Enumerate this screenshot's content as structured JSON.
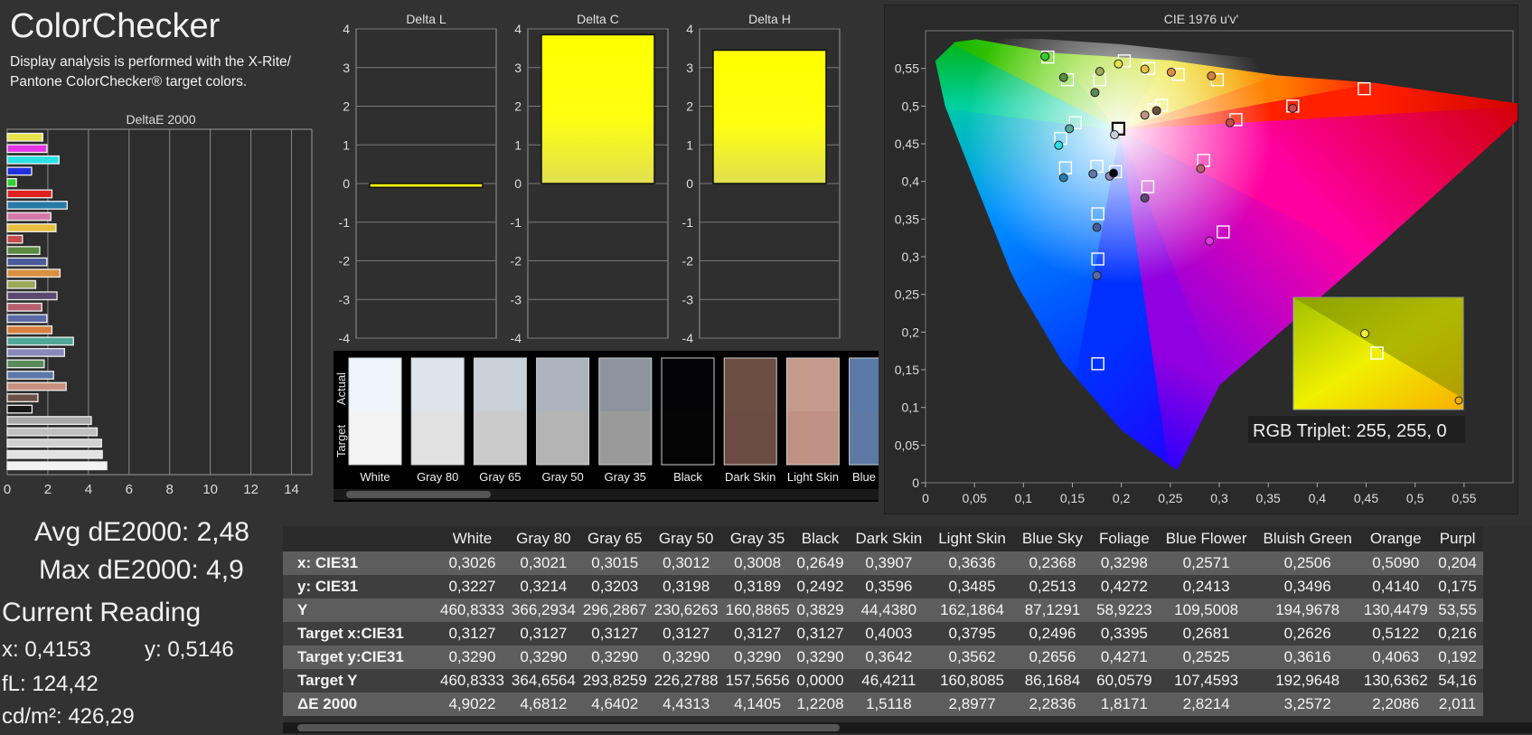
{
  "title": "ColorChecker",
  "subtitle": "Display analysis is performed with the X-Rite/ Pantone ColorChecker® target colors.",
  "de_chart": {
    "title": "DeltaE 2000",
    "xlim": [
      0,
      15
    ],
    "ticks": [
      "0",
      "2",
      "4",
      "6",
      "8",
      "10",
      "12",
      "14"
    ],
    "tick_values": [
      0,
      2,
      4,
      6,
      8,
      10,
      12,
      14
    ],
    "bars": [
      {
        "v": 1.75,
        "c": "#e8e34a"
      },
      {
        "v": 1.95,
        "c": "#e535e5"
      },
      {
        "v": 2.55,
        "c": "#2ae0e4"
      },
      {
        "v": 1.2,
        "c": "#2030e0"
      },
      {
        "v": 0.45,
        "c": "#30d030"
      },
      {
        "v": 2.2,
        "c": "#e02020"
      },
      {
        "v": 2.95,
        "c": "#2a7aa8"
      },
      {
        "v": 2.15,
        "c": "#d57aa8"
      },
      {
        "v": 2.4,
        "c": "#e8c040"
      },
      {
        "v": 0.75,
        "c": "#c84a4a"
      },
      {
        "v": 1.6,
        "c": "#5a8a40"
      },
      {
        "v": 1.95,
        "c": "#4a5a9a"
      },
      {
        "v": 2.6,
        "c": "#d89040"
      },
      {
        "v": 1.4,
        "c": "#9aa858"
      },
      {
        "v": 2.45,
        "c": "#5a4870"
      },
      {
        "v": 1.7,
        "c": "#b86070"
      },
      {
        "v": 1.95,
        "c": "#5a6aa8"
      },
      {
        "v": 2.2,
        "c": "#d88040"
      },
      {
        "v": 3.26,
        "c": "#50a898"
      },
      {
        "v": 2.82,
        "c": "#8a88b8"
      },
      {
        "v": 1.82,
        "c": "#5a8a58"
      },
      {
        "v": 2.28,
        "c": "#5a78a8"
      },
      {
        "v": 2.9,
        "c": "#c89080"
      },
      {
        "v": 1.51,
        "c": "#6a5048"
      },
      {
        "v": 1.22,
        "c": "#181818"
      },
      {
        "v": 4.14,
        "c": "#a8a8a8"
      },
      {
        "v": 4.43,
        "c": "#c0c0c0"
      },
      {
        "v": 4.64,
        "c": "#d0d0d0"
      },
      {
        "v": 4.68,
        "c": "#e2e2e2"
      },
      {
        "v": 4.9,
        "c": "#f2f2f2"
      }
    ]
  },
  "stats": {
    "avg": "Avg dE2000: 2,48",
    "max": "Max dE2000: 4,9",
    "current_title": "Current Reading",
    "x": "x: 0,4153",
    "y": "y: 0,5146",
    "fl": "fL: 124,42",
    "cd": "cd/m²: 426,29"
  },
  "delta_charts": {
    "y_ticks": [
      "4",
      "3",
      "2",
      "1",
      "0",
      "-1",
      "-2",
      "-3",
      "-4"
    ],
    "y_tick_values": [
      4,
      3,
      2,
      1,
      0,
      -1,
      -2,
      -3,
      -4
    ],
    "items": [
      {
        "title": "Delta L",
        "value": -0.1
      },
      {
        "title": "Delta C",
        "value": 3.85
      },
      {
        "title": "Delta H",
        "value": 3.45
      }
    ],
    "bar_color": "#ffff00"
  },
  "swatches": {
    "actual_label": "Actual",
    "target_label": "Target",
    "items": [
      {
        "name": "White",
        "actual": "#eef6fc",
        "target": "#f3f3f3"
      },
      {
        "name": "Gray 80",
        "actual": "#dde4ec",
        "target": "#e2e2e2"
      },
      {
        "name": "Gray 65",
        "actual": "#c8d0d8",
        "target": "#cbcbcb"
      },
      {
        "name": "Gray 50",
        "actual": "#adb4bd",
        "target": "#b4b4b4"
      },
      {
        "name": "Gray 35",
        "actual": "#8e949d",
        "target": "#9a9a9a"
      },
      {
        "name": "Black",
        "actual": "#040406",
        "target": "#050505"
      },
      {
        "name": "Dark Skin",
        "actual": "#6d4e42",
        "target": "#6c4c42"
      },
      {
        "name": "Light Skin",
        "actual": "#c59a8c",
        "target": "#c09286"
      },
      {
        "name": "Blue Sky",
        "actual": "#5a7aa8",
        "target": "#5e7aa4"
      }
    ]
  },
  "cie_chart": {
    "title": "CIE 1976 u'v'",
    "x_ticks": [
      "0",
      "0,05",
      "0,1",
      "0,15",
      "0,2",
      "0,25",
      "0,3",
      "0,35",
      "0,4",
      "0,45",
      "0,5",
      "0,55"
    ],
    "x_tick_values": [
      0,
      0.05,
      0.1,
      0.15,
      0.2,
      0.25,
      0.3,
      0.35,
      0.4,
      0.45,
      0.5,
      0.55
    ],
    "y_ticks": [
      "0",
      "0,05",
      "0,1",
      "0,15",
      "0,2",
      "0,25",
      "0,3",
      "0,35",
      "0,4",
      "0,45",
      "0,5",
      "0,55"
    ],
    "y_tick_values": [
      0,
      0.05,
      0.1,
      0.15,
      0.2,
      0.25,
      0.3,
      0.35,
      0.4,
      0.45,
      0.5,
      0.55
    ],
    "xlim": [
      0,
      0.6
    ],
    "ylim": [
      0,
      0.6
    ],
    "targets": [
      [
        0.125,
        0.565
      ],
      [
        0.145,
        0.535
      ],
      [
        0.178,
        0.535
      ],
      [
        0.203,
        0.56
      ],
      [
        0.228,
        0.55
      ],
      [
        0.258,
        0.542
      ],
      [
        0.298,
        0.535
      ],
      [
        0.448,
        0.523
      ],
      [
        0.375,
        0.5
      ],
      [
        0.241,
        0.501
      ],
      [
        0.233,
        0.495
      ],
      [
        0.317,
        0.482
      ],
      [
        0.153,
        0.478
      ],
      [
        0.138,
        0.457
      ],
      [
        0.197,
        0.47
      ],
      [
        0.143,
        0.418
      ],
      [
        0.175,
        0.42
      ],
      [
        0.194,
        0.413
      ],
      [
        0.284,
        0.428
      ],
      [
        0.227,
        0.393
      ],
      [
        0.176,
        0.357
      ],
      [
        0.304,
        0.333
      ],
      [
        0.176,
        0.297
      ],
      [
        0.176,
        0.158
      ]
    ],
    "actual_points": [
      {
        "u": 0.122,
        "v": 0.566,
        "c": "#30d030"
      },
      {
        "u": 0.141,
        "v": 0.538,
        "c": "#5a8a40"
      },
      {
        "u": 0.178,
        "v": 0.546,
        "c": "#9aa858"
      },
      {
        "u": 0.197,
        "v": 0.556,
        "c": "#e8e34a"
      },
      {
        "u": 0.224,
        "v": 0.549,
        "c": "#e8c040"
      },
      {
        "u": 0.251,
        "v": 0.545,
        "c": "#d89040"
      },
      {
        "u": 0.292,
        "v": 0.54,
        "c": "#d88040"
      },
      {
        "u": 0.375,
        "v": 0.497,
        "c": "#c84a4a"
      },
      {
        "u": 0.236,
        "v": 0.494,
        "c": "#6d4e42"
      },
      {
        "u": 0.224,
        "v": 0.488,
        "c": "#c09286"
      },
      {
        "u": 0.311,
        "v": 0.478,
        "c": "#c84a4a"
      },
      {
        "u": 0.173,
        "v": 0.518,
        "c": "#5a8a58"
      },
      {
        "u": 0.147,
        "v": 0.47,
        "c": "#50a898"
      },
      {
        "u": 0.136,
        "v": 0.448,
        "c": "#2ae0e4"
      },
      {
        "u": 0.193,
        "v": 0.462,
        "c": "#c8d0d8"
      },
      {
        "u": 0.141,
        "v": 0.405,
        "c": "#2a7aa8"
      },
      {
        "u": 0.171,
        "v": 0.41,
        "c": "#5a78a8"
      },
      {
        "u": 0.188,
        "v": 0.407,
        "c": "#8a88b8"
      },
      {
        "u": 0.192,
        "v": 0.411,
        "c": "#040406"
      },
      {
        "u": 0.281,
        "v": 0.417,
        "c": "#b86070"
      },
      {
        "u": 0.224,
        "v": 0.378,
        "c": "#5a4870"
      },
      {
        "u": 0.175,
        "v": 0.339,
        "c": "#4a5a9a"
      },
      {
        "u": 0.29,
        "v": 0.321,
        "c": "#e535e5"
      },
      {
        "u": 0.175,
        "v": 0.275,
        "c": "#5a6aa8"
      }
    ],
    "selected_target": [
      0.197,
      0.47
    ],
    "inset": {
      "actual": {
        "u": 0.5,
        "v": 0.52,
        "c": "#e8e34a"
      },
      "target_label": "RGB Triplet: 255, 255, 0"
    }
  },
  "table": {
    "columns": [
      "White",
      "Gray 80",
      "Gray 65",
      "Gray 50",
      "Gray 35",
      "Black",
      "Dark Skin",
      "Light Skin",
      "Blue Sky",
      "Foliage",
      "Blue Flower",
      "Bluish Green",
      "Orange",
      "Purpl"
    ],
    "rows": [
      {
        "label": "x: CIE31",
        "values": [
          "0,3026",
          "0,3021",
          "0,3015",
          "0,3012",
          "0,3008",
          "0,2649",
          "0,3907",
          "0,3636",
          "0,2368",
          "0,3298",
          "0,2571",
          "0,2506",
          "0,5090",
          "0,204"
        ]
      },
      {
        "label": "y: CIE31",
        "values": [
          "0,3227",
          "0,3214",
          "0,3203",
          "0,3198",
          "0,3189",
          "0,2492",
          "0,3596",
          "0,3485",
          "0,2513",
          "0,4272",
          "0,2413",
          "0,3496",
          "0,4140",
          "0,175"
        ]
      },
      {
        "label": "Y",
        "values": [
          "460,8333",
          "366,2934",
          "296,2867",
          "230,6263",
          "160,8865",
          "0,3829",
          "44,4380",
          "162,1864",
          "87,1291",
          "58,9223",
          "109,5008",
          "194,9678",
          "130,4479",
          "53,55"
        ]
      },
      {
        "label": "Target x:CIE31",
        "values": [
          "0,3127",
          "0,3127",
          "0,3127",
          "0,3127",
          "0,3127",
          "0,3127",
          "0,4003",
          "0,3795",
          "0,2496",
          "0,3395",
          "0,2681",
          "0,2626",
          "0,5122",
          "0,216"
        ]
      },
      {
        "label": "Target y:CIE31",
        "values": [
          "0,3290",
          "0,3290",
          "0,3290",
          "0,3290",
          "0,3290",
          "0,3290",
          "0,3642",
          "0,3562",
          "0,2656",
          "0,4271",
          "0,2525",
          "0,3616",
          "0,4063",
          "0,192"
        ]
      },
      {
        "label": "Target Y",
        "values": [
          "460,8333",
          "364,6564",
          "293,8259",
          "226,2788",
          "157,5656",
          "0,0000",
          "46,4211",
          "160,8085",
          "86,1684",
          "60,0579",
          "107,4593",
          "192,9648",
          "130,6362",
          "54,16"
        ]
      },
      {
        "label": "ΔE 2000",
        "values": [
          "4,9022",
          "4,6812",
          "4,6402",
          "4,4313",
          "4,1405",
          "1,2208",
          "1,5118",
          "2,8977",
          "2,2836",
          "1,8171",
          "2,8214",
          "3,2572",
          "2,2086",
          "2,011"
        ]
      }
    ]
  }
}
